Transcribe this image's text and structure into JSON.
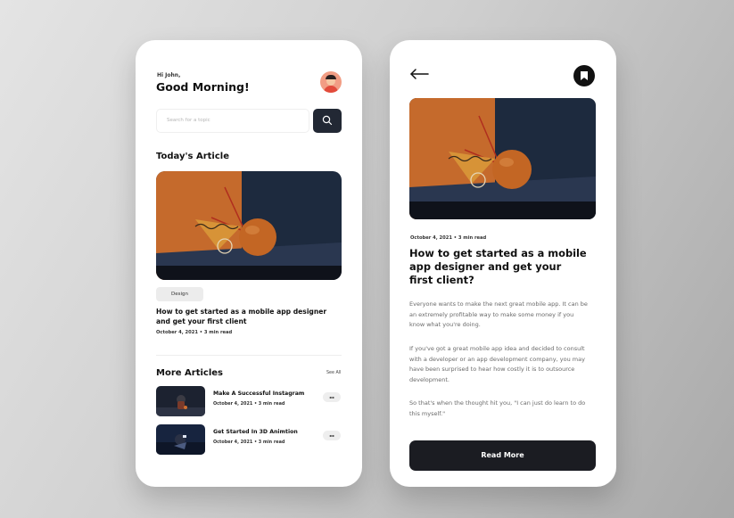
{
  "home": {
    "greeting_small": "Hi John,",
    "greeting": "Good Morning!",
    "search": {
      "placeholder": "Search for a topic"
    },
    "todays_article": {
      "section_title": "Today's Article",
      "tag": "Design",
      "title": "How to get started as a mobile app designer and get your first client",
      "meta": "October 4, 2021  •  3 min read"
    },
    "more_articles": {
      "section_title": "More Articles",
      "see_all": "See All",
      "items": [
        {
          "title": "Make A Successful Instagram",
          "meta": "October 4, 2021  •  3 min read",
          "bookmark_label": ""
        },
        {
          "title": "Get Started In 3D Animtion",
          "meta": "October 4, 2021  •  3 min read",
          "bookmark_label": ""
        }
      ]
    }
  },
  "detail": {
    "meta": "October 4, 2021  •  3 min read",
    "title": "How to get started as a mobile app designer and get your first client?",
    "paragraphs": [
      "Everyone wants to make the next great mobile app. It can be an extremely profitable way to make some money if you know what you're doing.",
      "If you've got a great mobile app idea and decided to consult with a developer or an app development company, you may have been surprised to hear how costly it is to outsource development.",
      "So that's when the thought hit you, \"I can just do learn to do this myself.\""
    ],
    "read_more": "Read More"
  },
  "icons": {
    "search": "search-icon",
    "back": "arrow-left-icon",
    "bookmark": "bookmark-icon",
    "avatar": "user-avatar"
  },
  "colors": {
    "dark_button": "#1b1c22",
    "search_button": "#222834",
    "avatar_bg": "#f29d84",
    "art_orange": "#c96a2a",
    "art_navy": "#1d2a3e"
  }
}
